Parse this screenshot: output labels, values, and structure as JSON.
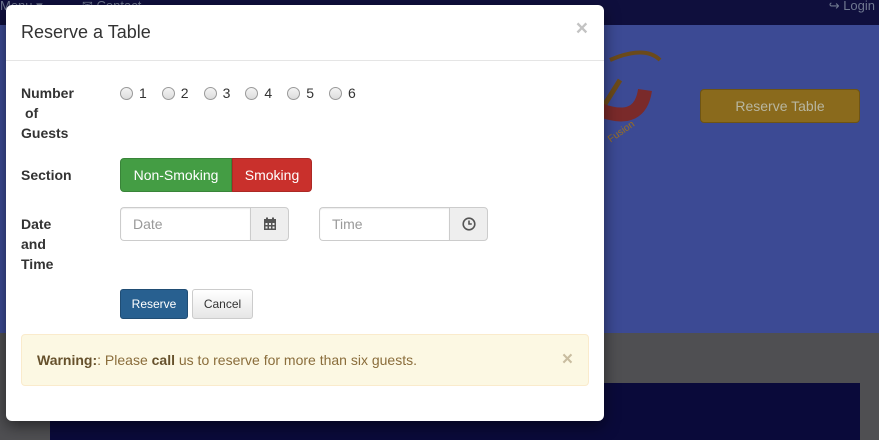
{
  "background": {
    "nav": {
      "menu": "Menu ▾",
      "contact": "✉ Contact",
      "login": "↪ Login"
    },
    "reserve_button": "Reserve Table",
    "logo_text": "Fusion"
  },
  "modal": {
    "title": "Reserve a Table",
    "close": "×",
    "guests": {
      "label_lines": [
        "Number",
        "of",
        "Guests"
      ],
      "options": [
        "1",
        "2",
        "3",
        "4",
        "5",
        "6"
      ]
    },
    "section": {
      "label": "Section",
      "non_smoking": "Non-Smoking",
      "smoking": "Smoking"
    },
    "datetime": {
      "label_lines": [
        "Date",
        "and",
        "Time"
      ],
      "date_placeholder": "Date",
      "time_placeholder": "Time",
      "date_icon": "calendar-icon",
      "time_icon": "clock-icon"
    },
    "actions": {
      "reserve": "Reserve",
      "cancel": "Cancel"
    },
    "alert": {
      "strong": "Warning:",
      "pre": ": Please ",
      "bold_word": "call",
      "post": " us to reserve for more than six guests.",
      "close": "×"
    }
  },
  "colors": {
    "non_smoking": "#449d44",
    "smoking": "#c9302c",
    "primary": "#286090",
    "warning_bg": "#fcf8e3"
  }
}
